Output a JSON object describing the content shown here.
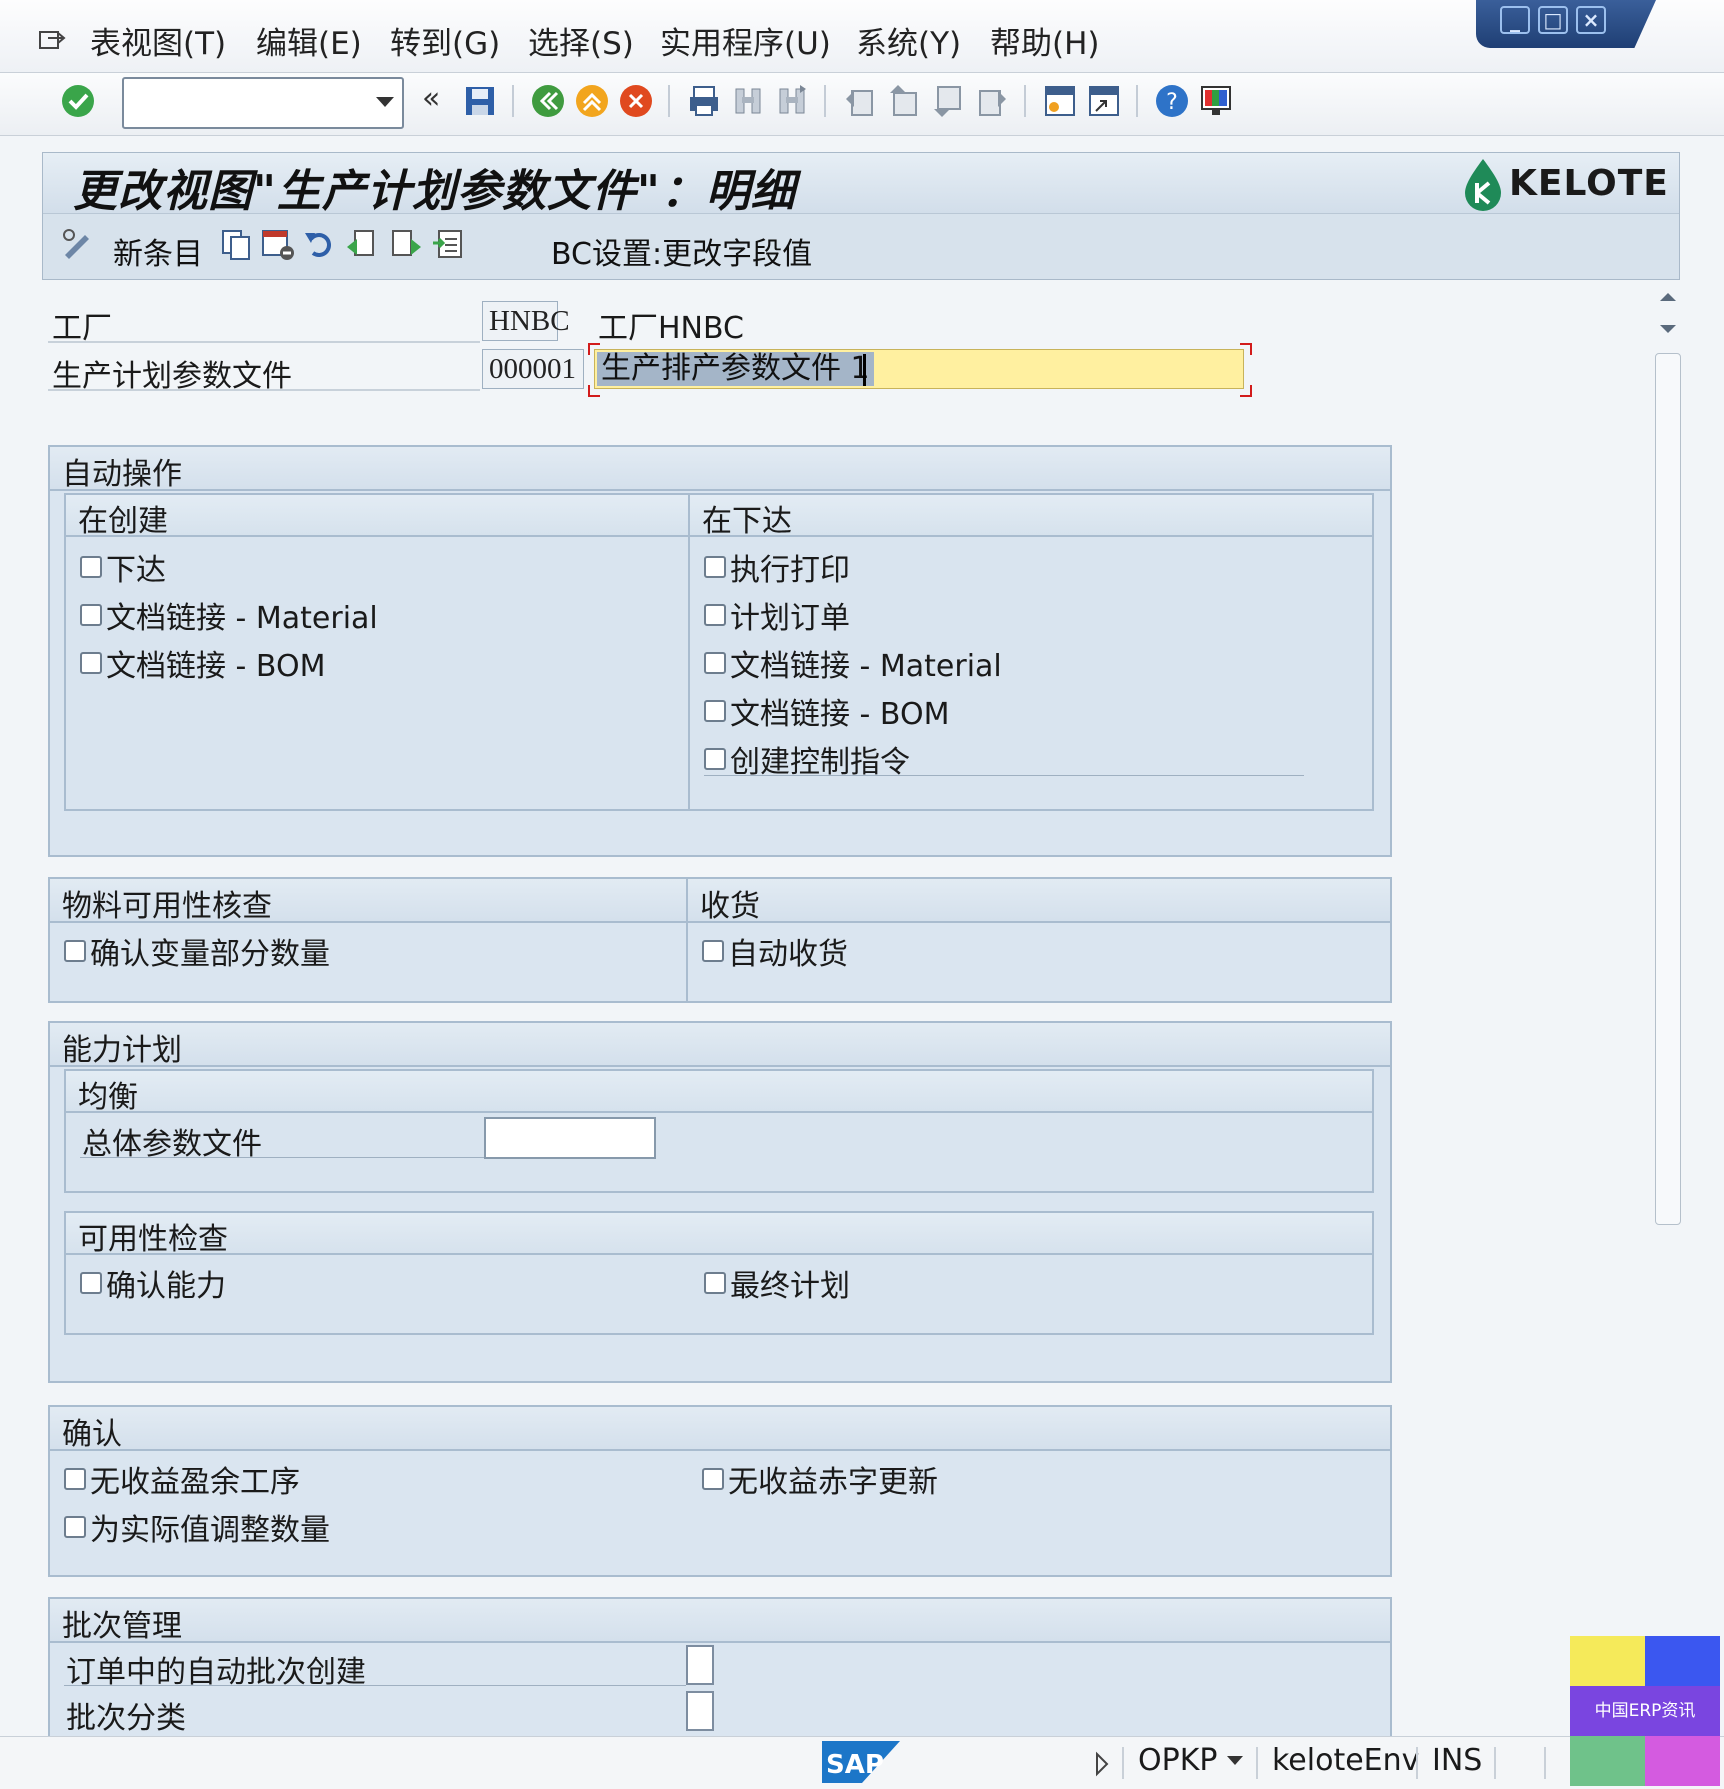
{
  "menu": {
    "items": [
      "表视图(T)",
      "编辑(E)",
      "转到(G)",
      "选择(S)",
      "实用程序(U)",
      "系统(Y)",
      "帮助(H)"
    ]
  },
  "toolbar": {
    "command_field_value": "",
    "icons": [
      "enter-check-icon",
      "command-dropdown-icon",
      "collapse-icon",
      "save-icon",
      "back-icon",
      "exit-icon",
      "cancel-icon",
      "print-icon",
      "find-icon",
      "find-next-icon",
      "first-page-icon",
      "previous-page-icon",
      "next-page-icon",
      "last-page-icon",
      "create-session-icon",
      "shortcut-icon",
      "help-icon",
      "customize-layout-icon"
    ]
  },
  "title": {
    "text": "更改视图\"生产计划参数文件\"：明细",
    "logo": "KELOTE"
  },
  "app_toolbar": {
    "new_entries": "新条目",
    "bc_set": "BC设置:更改字段值"
  },
  "header": {
    "plant_label": "工厂",
    "plant_value": "HNBC",
    "plant_text": "工厂HNBC",
    "profile_label": "生产计划参数文件",
    "profile_value": "000001",
    "profile_desc": "生产排产参数文件 1"
  },
  "auto_ops": {
    "title": "自动操作",
    "on_create": {
      "title": "在创建",
      "items": [
        "下达",
        "文档链接 - Material",
        "文档链接 - BOM"
      ]
    },
    "on_release": {
      "title": "在下达",
      "items": [
        "执行打印",
        "计划订单",
        "文档链接 - Material",
        "文档链接 - BOM",
        "创建控制指令"
      ]
    }
  },
  "material_check": {
    "title": "物料可用性核查",
    "items": [
      "确认变量部分数量"
    ]
  },
  "goods_receipt": {
    "title": "收货",
    "items": [
      "自动收货"
    ]
  },
  "capacity": {
    "title": "能力计划",
    "leveling": {
      "title": "均衡",
      "overall_profile_label": "总体参数文件",
      "overall_profile_value": ""
    },
    "availability": {
      "title": "可用性检查",
      "left": "确认能力",
      "right": "最终计划"
    }
  },
  "confirmation": {
    "title": "确认",
    "left": [
      "无收益盈余工序",
      "为实际值调整数量"
    ],
    "right": [
      "无收益赤字更新"
    ]
  },
  "batch": {
    "title": "批次管理",
    "items": [
      "订单中的自动批次创建",
      "批次分类"
    ]
  },
  "status": {
    "sap": "SAP",
    "tcode": "OPKP",
    "system": "keloteEnv",
    "mode": "INS"
  },
  "watermark": {
    "text": "中国ERP资讯",
    "colors": [
      "#f5ea5a",
      "#3b57f0",
      "#6fc28a",
      "#d45be0"
    ]
  },
  "colors": {
    "accent_input": "#fff0a0",
    "group_bg": "#dae5f0",
    "title_bg": "#d7e2ec"
  }
}
